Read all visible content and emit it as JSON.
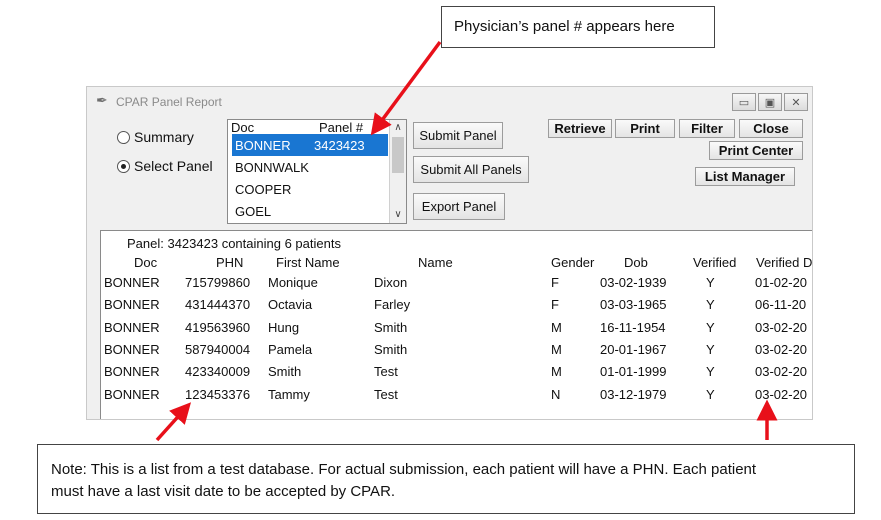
{
  "callouts": {
    "top": "Physician’s panel # appears here",
    "bottom_line1": "Note: This is a list from a test database. For actual submission, each patient will have a PHN. Each patient",
    "bottom_line2": "must have a last visit date to be accepted by CPAR."
  },
  "window": {
    "title": "CPAR Panel Report",
    "controls": [
      "▭",
      "▣",
      "✕"
    ]
  },
  "mode": {
    "summary_label": "Summary",
    "select_panel_label": "Select Panel",
    "selected": "Select Panel"
  },
  "doc_list": {
    "header_doc": "Doc",
    "header_panel": "Panel #",
    "items": [
      {
        "doc": "BONNER",
        "panel": "3423423",
        "selected": true
      },
      {
        "doc": "BONNWALK",
        "panel": ""
      },
      {
        "doc": "COOPER",
        "panel": ""
      },
      {
        "doc": "GOEL",
        "panel": ""
      }
    ]
  },
  "buttons": {
    "submit_panel": "Submit Panel",
    "submit_all": "Submit All Panels",
    "export_panel": "Export Panel",
    "retrieve": "Retrieve",
    "print": "Print",
    "filter": "Filter",
    "close": "Close",
    "print_center": "Print Center",
    "list_manager": "List Manager"
  },
  "table": {
    "panel_summary": "Panel: 3423423 containing 6 patients",
    "columns": [
      "Doc",
      "PHN",
      "First Name",
      "Name",
      "Gender",
      "Dob",
      "Verified",
      "Verified D"
    ],
    "rows": [
      [
        "BONNER",
        "715799860",
        "Monique",
        "Dixon",
        "F",
        "03-02-1939",
        "Y",
        "01-02-20"
      ],
      [
        "BONNER",
        "431444370",
        "Octavia",
        "Farley",
        "F",
        "03-03-1965",
        "Y",
        "06-11-20"
      ],
      [
        "BONNER",
        "419563960",
        "Hung",
        "Smith",
        "M",
        "16-11-1954",
        "Y",
        "03-02-20"
      ],
      [
        "BONNER",
        "587940004",
        "Pamela",
        "Smith",
        "M",
        "20-01-1967",
        "Y",
        "03-02-20"
      ],
      [
        "BONNER",
        "423340009",
        "Smith",
        "Test",
        "M",
        "01-01-1999",
        "Y",
        "03-02-20"
      ],
      [
        "BONNER",
        "123453376",
        "Tammy",
        "Test",
        "N",
        "03-12-1979",
        "Y",
        "03-02-20"
      ]
    ]
  },
  "colors": {
    "selection": "#1976d2",
    "arrow": "#e8101a"
  }
}
